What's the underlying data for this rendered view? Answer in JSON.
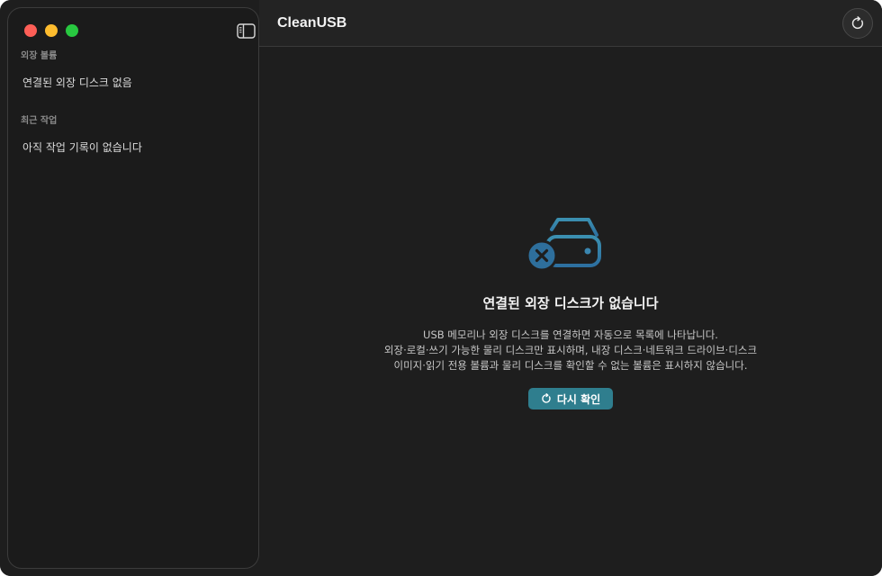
{
  "window": {
    "title": "CleanUSB",
    "traffic_lights": {
      "close": "#fe5f57",
      "minimize": "#febc2e",
      "zoom": "#28c840"
    }
  },
  "sidebar": {
    "toggle_icon": "sidebar-toggle-icon",
    "sections": [
      {
        "title": "외장 볼륨",
        "item": "연결된 외장 디스크 없음"
      },
      {
        "title": "최근 작업",
        "item": "아직 작업 기록이 없습니다"
      }
    ]
  },
  "toolbar": {
    "refresh_icon": "refresh-icon"
  },
  "empty_state": {
    "icon": "disk-error-icon",
    "title": "연결된 외장 디스크가 없습니다",
    "description_lines": [
      "USB 메모리나 외장 디스크를 연결하면 자동으로 목록에 나타납니다.",
      "외장·로컬·쓰기 가능한 물리 디스크만 표시하며, 내장 디스크·네트워크 드라이브·디스크",
      "이미지·읽기 전용 볼륨과 물리 디스크를 확인할 수 없는 볼륨은 표시하지 않습니다."
    ],
    "retry_label": "다시 확인",
    "accent_color": "#2f7e8e"
  }
}
